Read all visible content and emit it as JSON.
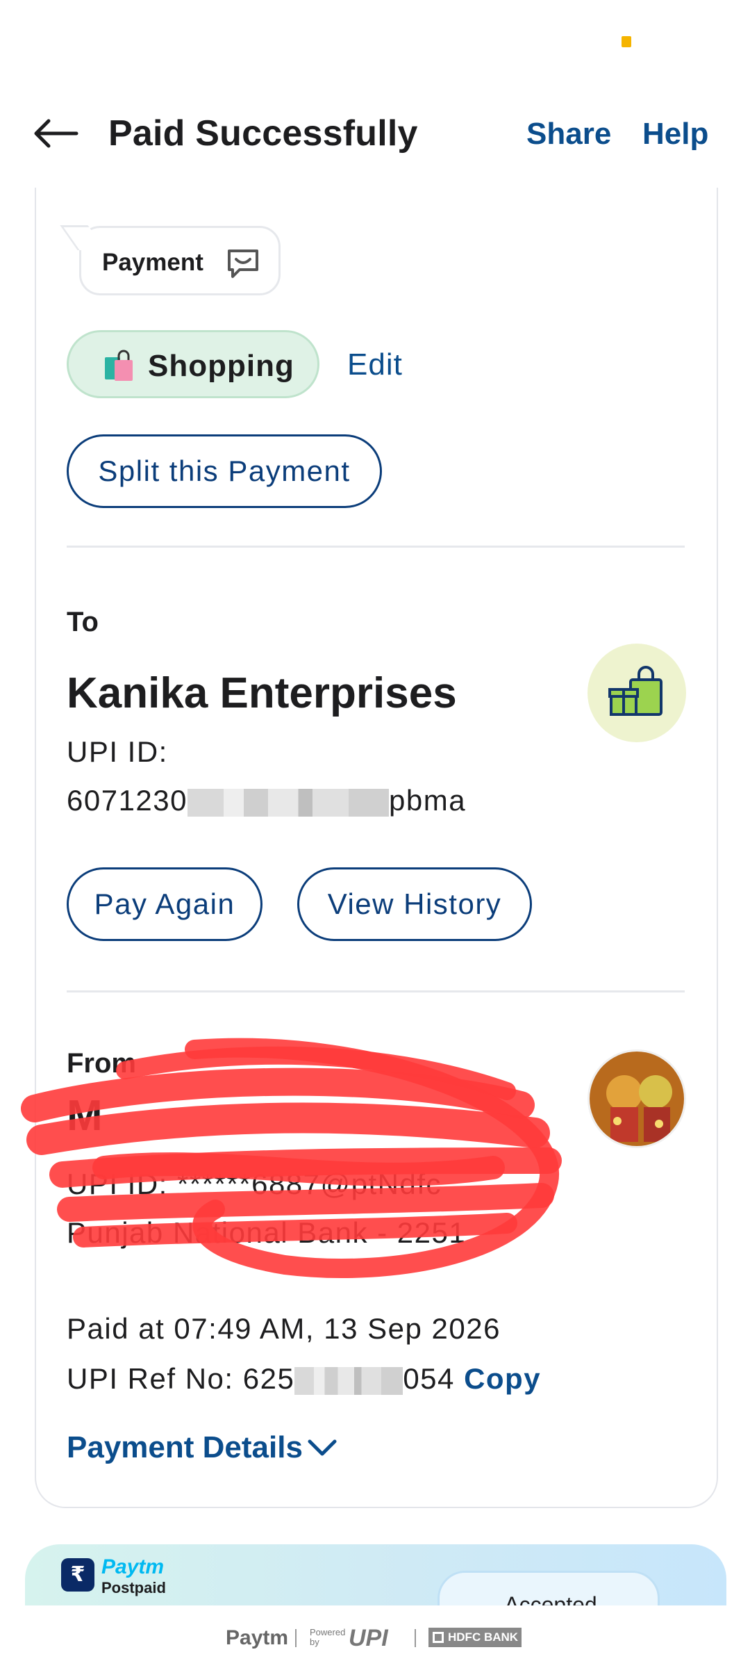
{
  "header": {
    "title": "Paid Successfully",
    "share_label": "Share",
    "help_label": "Help"
  },
  "note": {
    "label": "Payment"
  },
  "category": {
    "label": "Shopping",
    "edit_label": "Edit"
  },
  "split": {
    "label": "Split this Payment"
  },
  "to": {
    "label": "To",
    "name": "Kanika Enterprises",
    "upi_label": "UPI ID:",
    "upi_prefix": "6071230",
    "upi_suffix": "pbma",
    "pay_again_label": "Pay Again",
    "view_history_label": "View History"
  },
  "from": {
    "label": "From",
    "name": "M        ",
    "upi_text": "UPI ID: ******6887@ptNdfc",
    "bank_text": "Punjab National Bank - 2251"
  },
  "transaction": {
    "paid_at": "Paid at 07:49 AM, 13 Sep 2026",
    "ref_prefix": "UPI Ref No: 625",
    "ref_suffix": "054",
    "copy_label": "Copy",
    "details_label": "Payment Details"
  },
  "promo": {
    "brand": "Paytm",
    "sub": "Postpaid",
    "accepted_label": "Accepted"
  },
  "footer": {
    "paytm": "Paytm",
    "powered": "Powered by",
    "upi": "UPI",
    "bank": "HDFC BANK"
  },
  "colors": {
    "accent": "#0b4d8c",
    "chip_bg": "#dff2e6",
    "status_dot": "#f5b400"
  }
}
